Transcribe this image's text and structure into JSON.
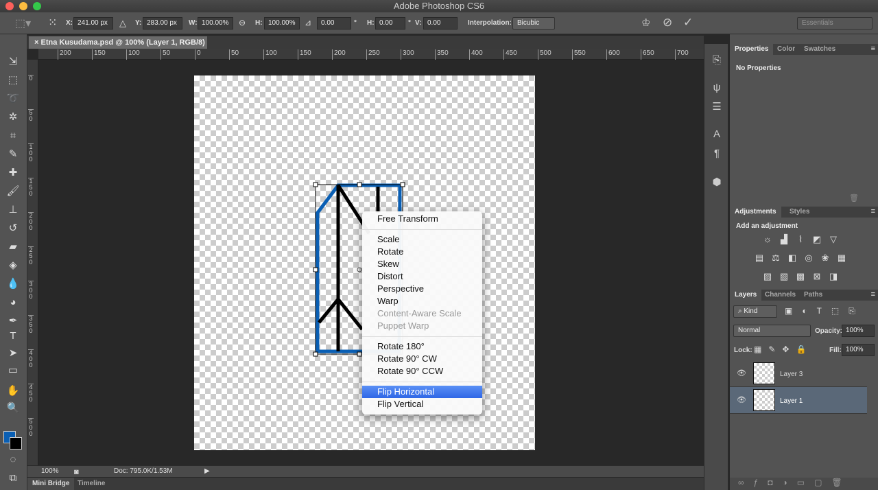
{
  "app_title": "Adobe Photoshop CS6",
  "options": {
    "x_label": "X:",
    "x": "241.00 px",
    "y_label": "Y:",
    "y": "283.00 px",
    "w_label": "W:",
    "w": "100.00%",
    "h_label": "H:",
    "h": "100.00%",
    "angle": "0.00",
    "deg": "°",
    "hskew_label": "H:",
    "hskew": "0.00",
    "vskew_label": "V:",
    "vskew": "0.00",
    "interp_label": "Interpolation:",
    "interp": "Bicubic",
    "workspace": "Essentials"
  },
  "document_tab": "Etna Kusudama.psd @ 100% (Layer 1, RGB/8)",
  "hruler": [
    "200",
    "150",
    "100",
    "50",
    "0",
    "50",
    "100",
    "150",
    "200",
    "250",
    "300",
    "350",
    "400",
    "450",
    "500",
    "550",
    "600",
    "650",
    "700"
  ],
  "vruler": [
    "0",
    "50",
    "100",
    "150",
    "200",
    "250",
    "300",
    "350",
    "400",
    "450",
    "500"
  ],
  "context_menu": {
    "items": [
      "Free Transform",
      "Scale",
      "Rotate",
      "Skew",
      "Distort",
      "Perspective",
      "Warp",
      "Content-Aware Scale",
      "Puppet Warp",
      "Rotate 180°",
      "Rotate 90° CW",
      "Rotate 90° CCW",
      "Flip Horizontal",
      "Flip Vertical"
    ],
    "disabled": [
      "Content-Aware Scale",
      "Puppet Warp"
    ],
    "highlighted": "Flip Horizontal"
  },
  "status": {
    "zoom": "100%",
    "doc": "Doc: 795.0K/1.53M"
  },
  "bottom_tabs": [
    "Mini Bridge",
    "Timeline"
  ],
  "properties": {
    "tabs": [
      "Properties",
      "Color",
      "Swatches"
    ],
    "content": "No Properties"
  },
  "adjustments": {
    "tabs": [
      "Adjustments",
      "Styles"
    ],
    "title": "Add an adjustment"
  },
  "layers": {
    "tabs": [
      "Layers",
      "Channels",
      "Paths"
    ],
    "filter": "Kind",
    "blend": "Normal",
    "opacity_label": "Opacity:",
    "opacity": "100%",
    "lock_label": "Lock:",
    "fill_label": "Fill:",
    "fill": "100%",
    "items": [
      {
        "name": "Layer 3",
        "selected": false
      },
      {
        "name": "Layer 1",
        "selected": true
      }
    ]
  },
  "colors": {
    "foreground": "#0a5fb4",
    "background": "#000000",
    "selection": "#5a6878",
    "accent": "#2f67e6"
  }
}
